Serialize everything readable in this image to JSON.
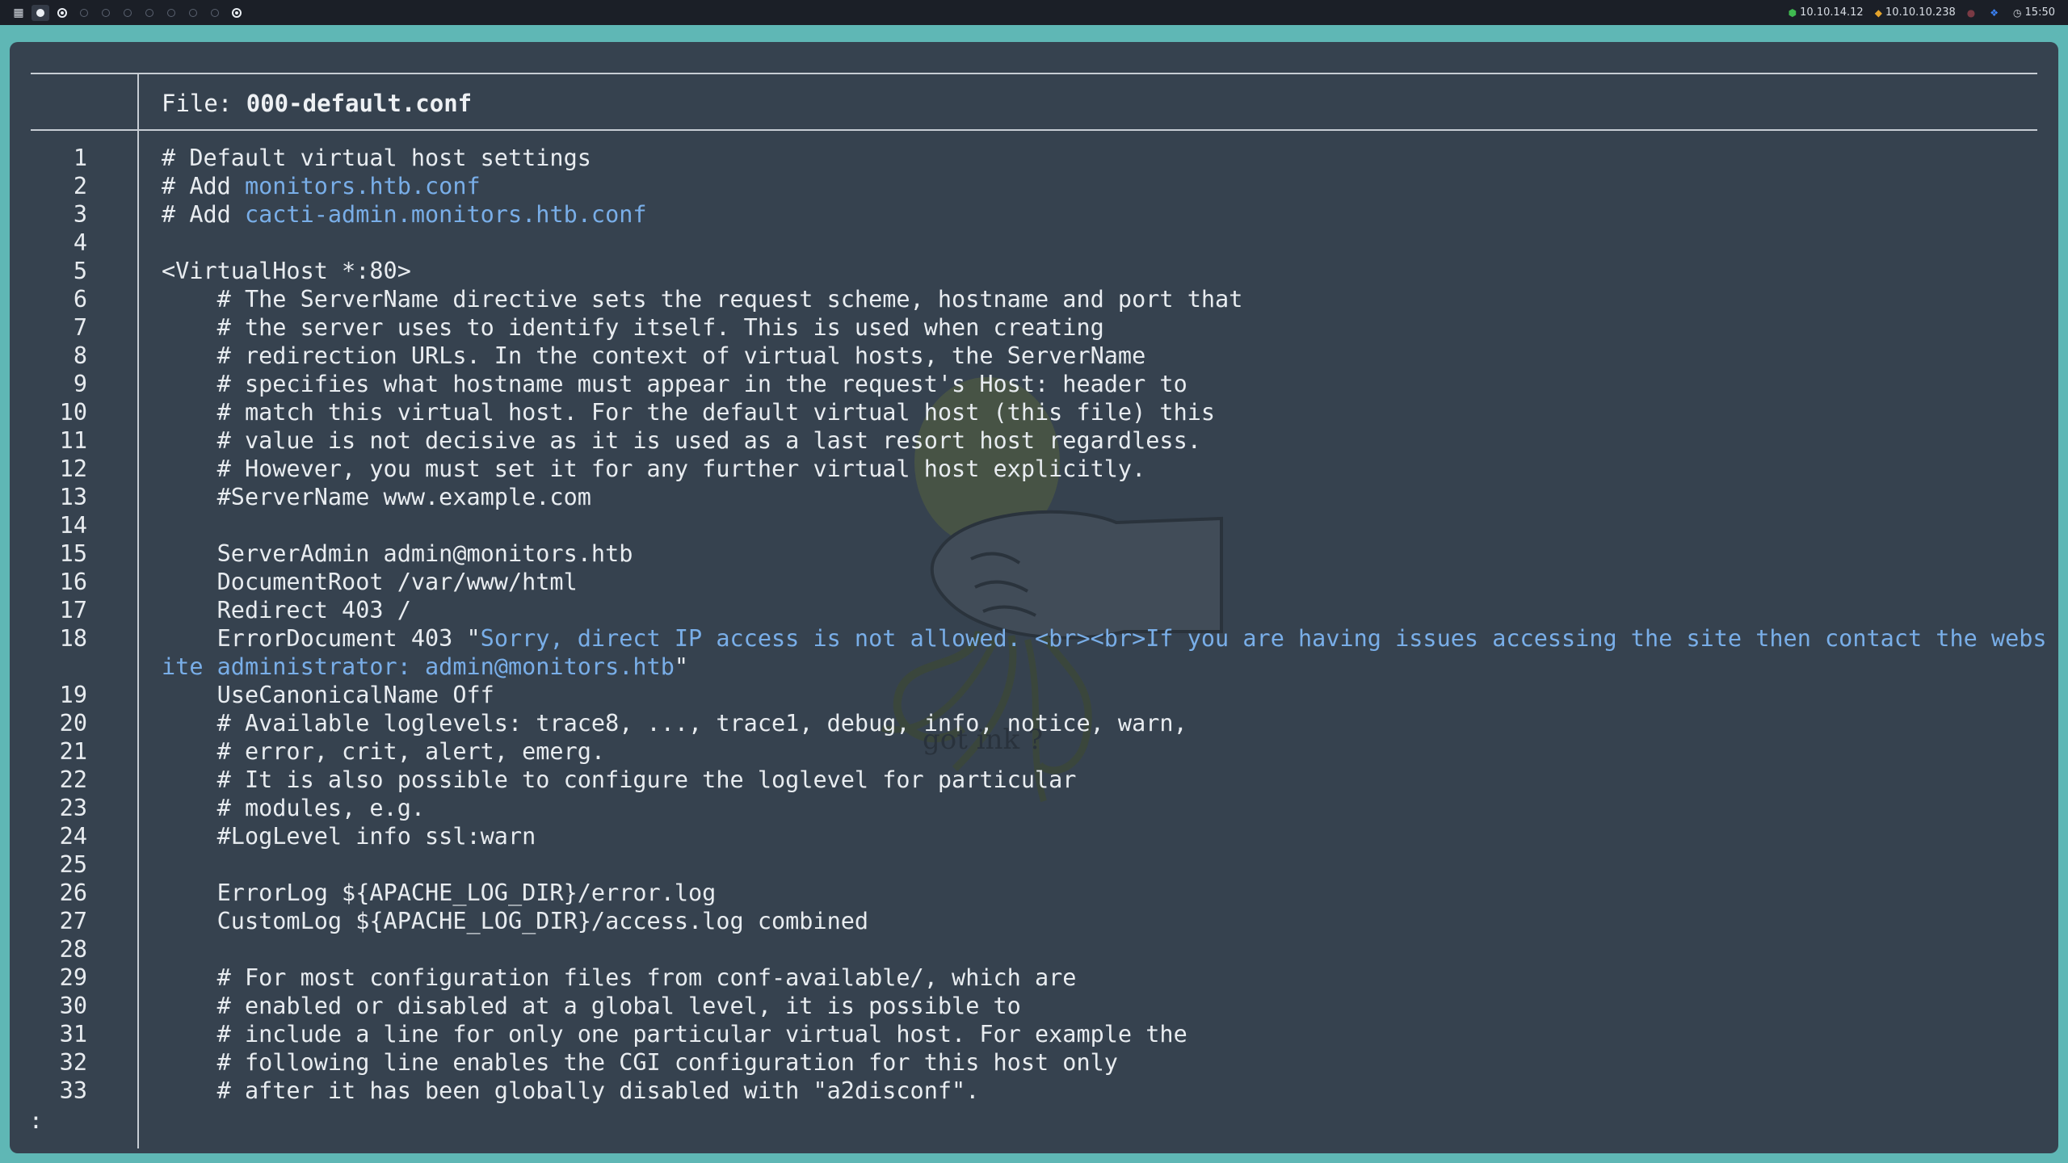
{
  "topbar": {
    "workspaces": [
      {
        "icon": "terminal-icon",
        "state": "app"
      },
      {
        "icon": "filled-dot-icon",
        "state": "active"
      },
      {
        "icon": "ring-dot-icon",
        "state": "occupied"
      },
      {
        "icon": "empty-dot-icon",
        "state": "empty"
      },
      {
        "icon": "empty-dot-icon",
        "state": "empty"
      },
      {
        "icon": "empty-dot-icon",
        "state": "empty"
      },
      {
        "icon": "empty-dot-icon",
        "state": "empty"
      },
      {
        "icon": "empty-dot-icon",
        "state": "empty"
      },
      {
        "icon": "empty-dot-icon",
        "state": "empty"
      },
      {
        "icon": "ring-dot-icon",
        "state": "occupied"
      }
    ],
    "local_ip": "10.10.14.12",
    "target_ip": "10.10.10.238",
    "clock": "15:50",
    "colors": {
      "local_ip_icon": "#3fb950",
      "target_ip_icon": "#e3a32b",
      "extra_icon": "#3b82f6",
      "clock_icon": "#c9d1d9"
    }
  },
  "pager": {
    "file_label": "File: ",
    "file_name": "000-default.conf",
    "prompt": ":",
    "lines": [
      {
        "n": "1",
        "text": "# Default virtual host settings"
      },
      {
        "n": "2",
        "pre": "# Add ",
        "hl": "monitors.htb.conf"
      },
      {
        "n": "3",
        "pre": "# Add ",
        "hl": "cacti-admin.monitors.htb.conf"
      },
      {
        "n": "4",
        "text": ""
      },
      {
        "n": "5",
        "text": "<VirtualHost *:80>"
      },
      {
        "n": "6",
        "text": "    # The ServerName directive sets the request scheme, hostname and port that"
      },
      {
        "n": "7",
        "text": "    # the server uses to identify itself. This is used when creating"
      },
      {
        "n": "8",
        "text": "    # redirection URLs. In the context of virtual hosts, the ServerName"
      },
      {
        "n": "9",
        "text": "    # specifies what hostname must appear in the request's Host: header to"
      },
      {
        "n": "10",
        "text": "    # match this virtual host. For the default virtual host (this file) this"
      },
      {
        "n": "11",
        "text": "    # value is not decisive as it is used as a last resort host regardless."
      },
      {
        "n": "12",
        "text": "    # However, you must set it for any further virtual host explicitly."
      },
      {
        "n": "13",
        "text": "    #ServerName www.example.com"
      },
      {
        "n": "14",
        "text": ""
      },
      {
        "n": "15",
        "text": "    ServerAdmin admin@monitors.htb"
      },
      {
        "n": "16",
        "text": "    DocumentRoot /var/www/html"
      },
      {
        "n": "17",
        "text": "    Redirect 403 /"
      },
      {
        "n": "18",
        "pre": "    ErrorDocument 403 \"",
        "hl": "Sorry, direct IP access is not allowed. <br><br>If you are having issues accessing the site then contact the website administrator: admin@monitors.htb",
        "post": "\""
      },
      {
        "n": "19",
        "text": "    UseCanonicalName Off"
      },
      {
        "n": "20",
        "text": "    # Available loglevels: trace8, ..., trace1, debug, info, notice, warn,"
      },
      {
        "n": "21",
        "text": "    # error, crit, alert, emerg."
      },
      {
        "n": "22",
        "text": "    # It is also possible to configure the loglevel for particular"
      },
      {
        "n": "23",
        "text": "    # modules, e.g."
      },
      {
        "n": "24",
        "text": "    #LogLevel info ssl:warn"
      },
      {
        "n": "25",
        "text": ""
      },
      {
        "n": "26",
        "text": "    ErrorLog ${APACHE_LOG_DIR}/error.log"
      },
      {
        "n": "27",
        "text": "    CustomLog ${APACHE_LOG_DIR}/access.log combined"
      },
      {
        "n": "28",
        "text": ""
      },
      {
        "n": "29",
        "text": "    # For most configuration files from conf-available/, which are"
      },
      {
        "n": "30",
        "text": "    # enabled or disabled at a global level, it is possible to"
      },
      {
        "n": "31",
        "text": "    # include a line for only one particular virtual host. For example the"
      },
      {
        "n": "32",
        "text": "    # following line enables the CGI configuration for this host only"
      },
      {
        "n": "33",
        "text": "    # after it has been globally disabled with \"a2disconf\"."
      }
    ]
  },
  "wallpaper": {
    "caption": "got ink ?"
  },
  "colors": {
    "desktop_bg": "#5fb7b5",
    "terminal_bg": "#36424f",
    "text": "#e8ecf0",
    "highlight": "#79aee8",
    "bar_bg": "#1b1f27"
  }
}
